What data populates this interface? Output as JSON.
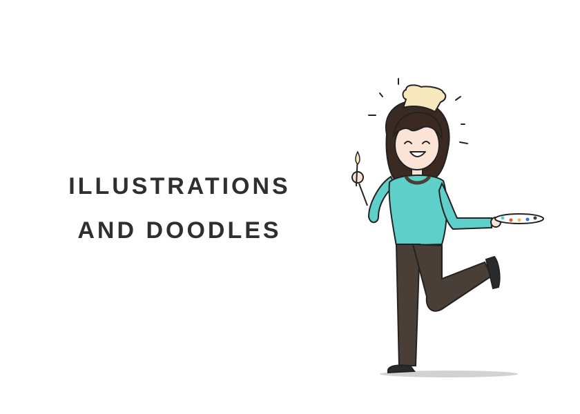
{
  "heading": {
    "line1": "ILLUSTRATIONS",
    "line2": "AND DOODLES"
  },
  "illustration": {
    "icon": "artist-girl-doodle",
    "colors": {
      "shirt": "#5fcfc9",
      "pants": "#4a3f37",
      "hair": "#3a2a22",
      "hat": "#f7e9bd",
      "skin": "#fbe4d6",
      "outline": "#222222",
      "shadow": "#cfcfcf"
    }
  }
}
